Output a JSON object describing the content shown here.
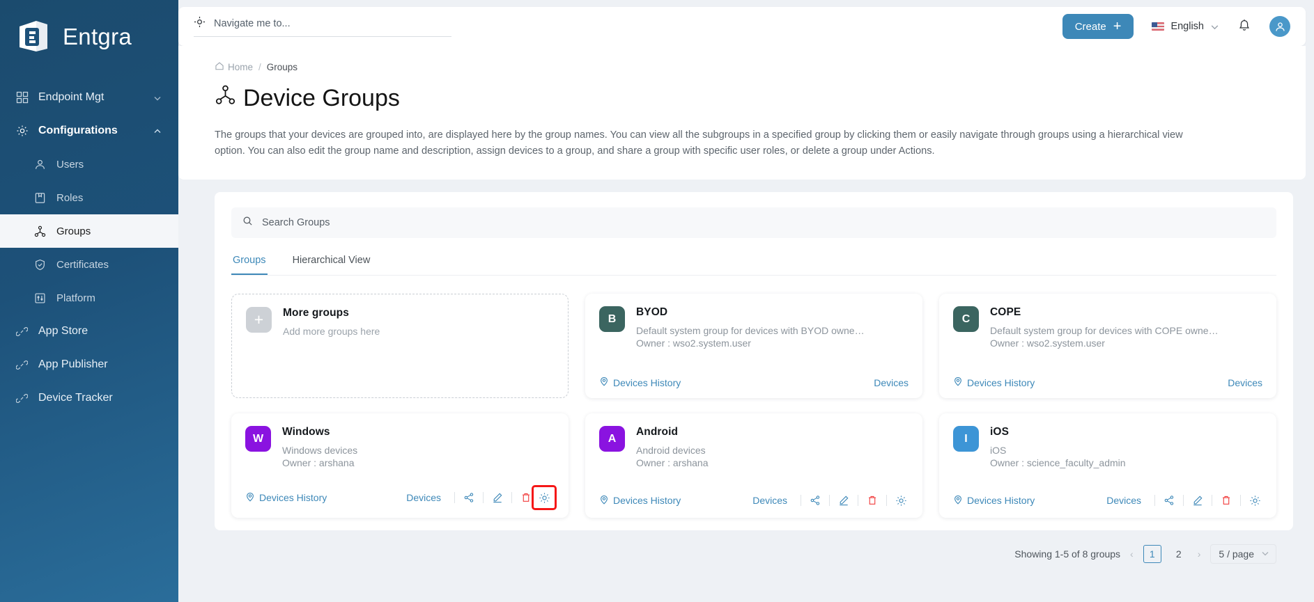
{
  "sidebar": {
    "brand": "Entgra",
    "items": [
      {
        "label": "Endpoint Mgt",
        "icon": "grid-icon",
        "level": "top",
        "expanded": false
      },
      {
        "label": "Configurations",
        "icon": "gear-icon",
        "level": "top",
        "expanded": true
      },
      {
        "label": "Users",
        "icon": "user-icon",
        "level": "sub"
      },
      {
        "label": "Roles",
        "icon": "book-icon",
        "level": "sub"
      },
      {
        "label": "Groups",
        "icon": "groups-icon",
        "level": "sub",
        "selected": true
      },
      {
        "label": "Certificates",
        "icon": "shield-check-icon",
        "level": "sub"
      },
      {
        "label": "Platform",
        "icon": "sliders-icon",
        "level": "sub"
      },
      {
        "label": "App Store",
        "icon": "link-icon",
        "level": "top"
      },
      {
        "label": "App Publisher",
        "icon": "link-icon",
        "level": "top"
      },
      {
        "label": "Device Tracker",
        "icon": "link-icon",
        "level": "top"
      }
    ]
  },
  "topbar": {
    "navigate_placeholder": "Navigate me to...",
    "navigate_value": "",
    "create_label": "Create",
    "create_plus": "+",
    "language": "English",
    "notifications_icon": "bell-icon",
    "avatar_icon": "user-avatar-icon"
  },
  "breadcrumb": {
    "home": "Home",
    "separator": "/",
    "current": "Groups"
  },
  "page": {
    "title": "Device Groups",
    "description": "The groups that your devices are grouped into, are displayed here by the group names. You can view all the subgroups in a specified group by clicking them or easily navigate through groups using a hierarchical view option. You can also edit the group name and description, assign devices to a group, and share a group with specific user roles, or delete a group under Actions."
  },
  "search": {
    "placeholder": "Search Groups",
    "value": ""
  },
  "tabs": [
    {
      "label": "Groups",
      "active": true
    },
    {
      "label": "Hierarchical View",
      "active": false
    }
  ],
  "add_card": {
    "title": "More groups",
    "subtitle": "Add more groups here",
    "avatar_letter": "+"
  },
  "cards": [
    {
      "name": "BYOD",
      "letter": "B",
      "color": "#3b6560",
      "description": "Default system group for devices with BYOD owne…",
      "owner": "Owner : wso2.system.user",
      "devices_history": "Devices History",
      "devices": "Devices",
      "has_actions": false,
      "gear_highlighted": false
    },
    {
      "name": "COPE",
      "letter": "C",
      "color": "#3b6560",
      "description": "Default system group for devices with COPE owne…",
      "owner": "Owner : wso2.system.user",
      "devices_history": "Devices History",
      "devices": "Devices",
      "has_actions": false,
      "gear_highlighted": false
    },
    {
      "name": "Windows",
      "letter": "W",
      "color": "#8a13e0",
      "description": "Windows devices",
      "owner": "Owner : arshana",
      "devices_history": "Devices History",
      "devices": "Devices",
      "has_actions": true,
      "gear_highlighted": true
    },
    {
      "name": "Android",
      "letter": "A",
      "color": "#8a13e0",
      "description": "Android devices",
      "owner": "Owner : arshana",
      "devices_history": "Devices History",
      "devices": "Devices",
      "has_actions": true,
      "gear_highlighted": false
    },
    {
      "name": "iOS",
      "letter": "I",
      "color": "#3d95d6",
      "description": "iOS",
      "owner": "Owner : science_faculty_admin",
      "devices_history": "Devices History",
      "devices": "Devices",
      "has_actions": true,
      "gear_highlighted": false
    }
  ],
  "card_actions": {
    "share": "share-icon",
    "edit": "edit-pencil-icon",
    "delete": "trash-icon",
    "settings": "gear-icon"
  },
  "pagination": {
    "summary": "Showing 1-5 of 8 groups",
    "prev": "‹",
    "next": "›",
    "pages": [
      "1",
      "2"
    ],
    "active_page": "1",
    "page_size": "5 / page"
  },
  "colors": {
    "accent": "#3d88b8",
    "sidebar": "#1d5179",
    "danger": "#f51717",
    "muted": "#8c949c"
  }
}
